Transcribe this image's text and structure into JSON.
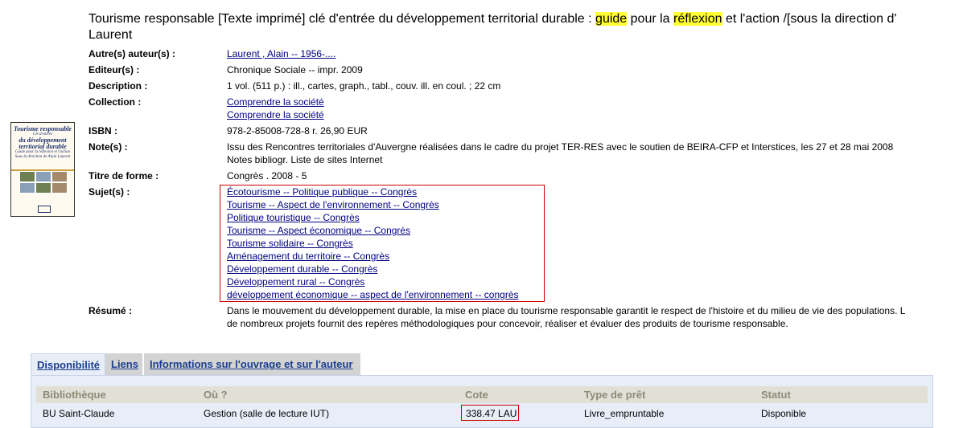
{
  "record": {
    "title_line1_pre": "Tourisme responsable [Texte imprimé] clé d'entrée du développement territorial durable : ",
    "title_hl1": "guide",
    "title_mid": " pour la ",
    "title_hl2": "réflexion",
    "title_post": " et l'action /[sous la direction d'",
    "title_line2": "Laurent",
    "cover": {
      "title_line1": "Tourisme responsable",
      "title_line2": "Clé d'entrée",
      "title_line3": "du développement",
      "title_line4": "territorial durable",
      "subtitle": "Guide pour la réflexion et l'action",
      "editor": "Sous la direction de Alain Laurent"
    },
    "fields": {
      "authors_label": "Autre(s) auteur(s) :",
      "authors_value": "Laurent , Alain -- 1956-....",
      "publisher_label": "Editeur(s) :",
      "publisher_value": "Chronique Sociale -- impr. 2009",
      "description_label": "Description :",
      "description_value": "1 vol. (511 p.) : ill., cartes, graph., tabl., couv. ill. en coul. ; 22 cm",
      "collection_label": "Collection :",
      "collection_values": [
        "Comprendre la société",
        "Comprendre la société"
      ],
      "isbn_label": "ISBN :",
      "isbn_value": "978-2-85008-728-8 r. 26,90 EUR",
      "notes_label": "Note(s) :",
      "notes_line1": "Issu des Rencontres territoriales d'Auvergne réalisées dans le cadre du projet TER-RES avec le soutien de BEIRA-CFP et Interstices, les 27 et 28 mai 2008",
      "notes_line2": "Notes bibliogr. Liste de sites Internet",
      "form_label": "Titre de forme :",
      "form_value": "Congrès . 2008 - 5",
      "subjects_label": "Sujet(s) :",
      "subjects": [
        "Écotourisme -- Politique publique -- Congrès",
        "Tourisme -- Aspect de l'environnement -- Congrès",
        "Politique touristique -- Congrès",
        "Tourisme -- Aspect économique -- Congrès",
        "Tourisme solidaire -- Congrès",
        "Aménagement du territoire -- Congrès",
        "Développement durable -- Congrès",
        "Développement rural -- Congrès",
        "développement économique -- aspect de l'environnement -- congrès"
      ],
      "summary_label": "Résumé :",
      "summary_line1": "Dans le mouvement du développement durable, la mise en place du tourisme responsable garantit le respect de l'histoire et du milieu de vie des populations. L",
      "summary_line2": "de nombreux projets fournit des repères méthodologiques pour concevoir, réaliser et évaluer des produits de tourisme responsable."
    }
  },
  "tabs": {
    "availability": "Disponibilité",
    "links": "Liens",
    "info": "Informations sur l'ouvrage et sur l'auteur"
  },
  "availability_table": {
    "headers": [
      "Bibliothèque",
      "Où ?",
      "Cote",
      "Type de prêt",
      "Statut"
    ],
    "rows": [
      [
        "BU Saint-Claude",
        "Gestion (salle de lecture IUT)",
        "338.47 LAU",
        "Livre_empruntable",
        "Disponible"
      ]
    ]
  },
  "colors": {
    "highlight": "#ffff33",
    "link": "#000080",
    "annotation_box": "#cc0000"
  }
}
